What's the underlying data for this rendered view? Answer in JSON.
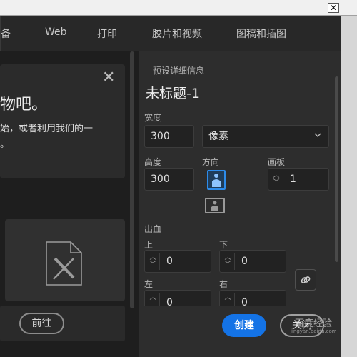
{
  "window": {
    "close_glyph": "✕"
  },
  "tabs": [
    {
      "label": "备"
    },
    {
      "label": "Web"
    },
    {
      "label": "打印"
    },
    {
      "label": "胶片和视频"
    },
    {
      "label": "图稿和插图"
    }
  ],
  "left_panel": {
    "card": {
      "close_glyph": "✕",
      "title": "物吧。",
      "text_line1": "始，或者利用我们的一",
      "text_line2": "。"
    },
    "file_icon": "document-with-ruler-pencil-icon",
    "prev_button": "前往"
  },
  "preset": {
    "section_label": "预设详细信息",
    "doc_name": "未标题-1",
    "width_label": "宽度",
    "width_value": "300",
    "unit_value": "像素",
    "height_label": "高度",
    "height_value": "300",
    "orientation_label": "方向",
    "artboard_label": "画板",
    "artboard_value": "1",
    "bleed_label": "出血",
    "top_label": "上",
    "top_value": "0",
    "bottom_label": "下",
    "bottom_value": "0",
    "left_label": "左",
    "left_value": "0",
    "right_label": "右",
    "right_value": "0",
    "link_icon": "link-icon"
  },
  "actions": {
    "create": "创建",
    "close": "关闭"
  },
  "watermark": {
    "text": "百度经验",
    "sub": "jingyan.baidu.com"
  },
  "colors": {
    "accent": "#1473e6",
    "orientation_selected": "#2d8ceb"
  }
}
